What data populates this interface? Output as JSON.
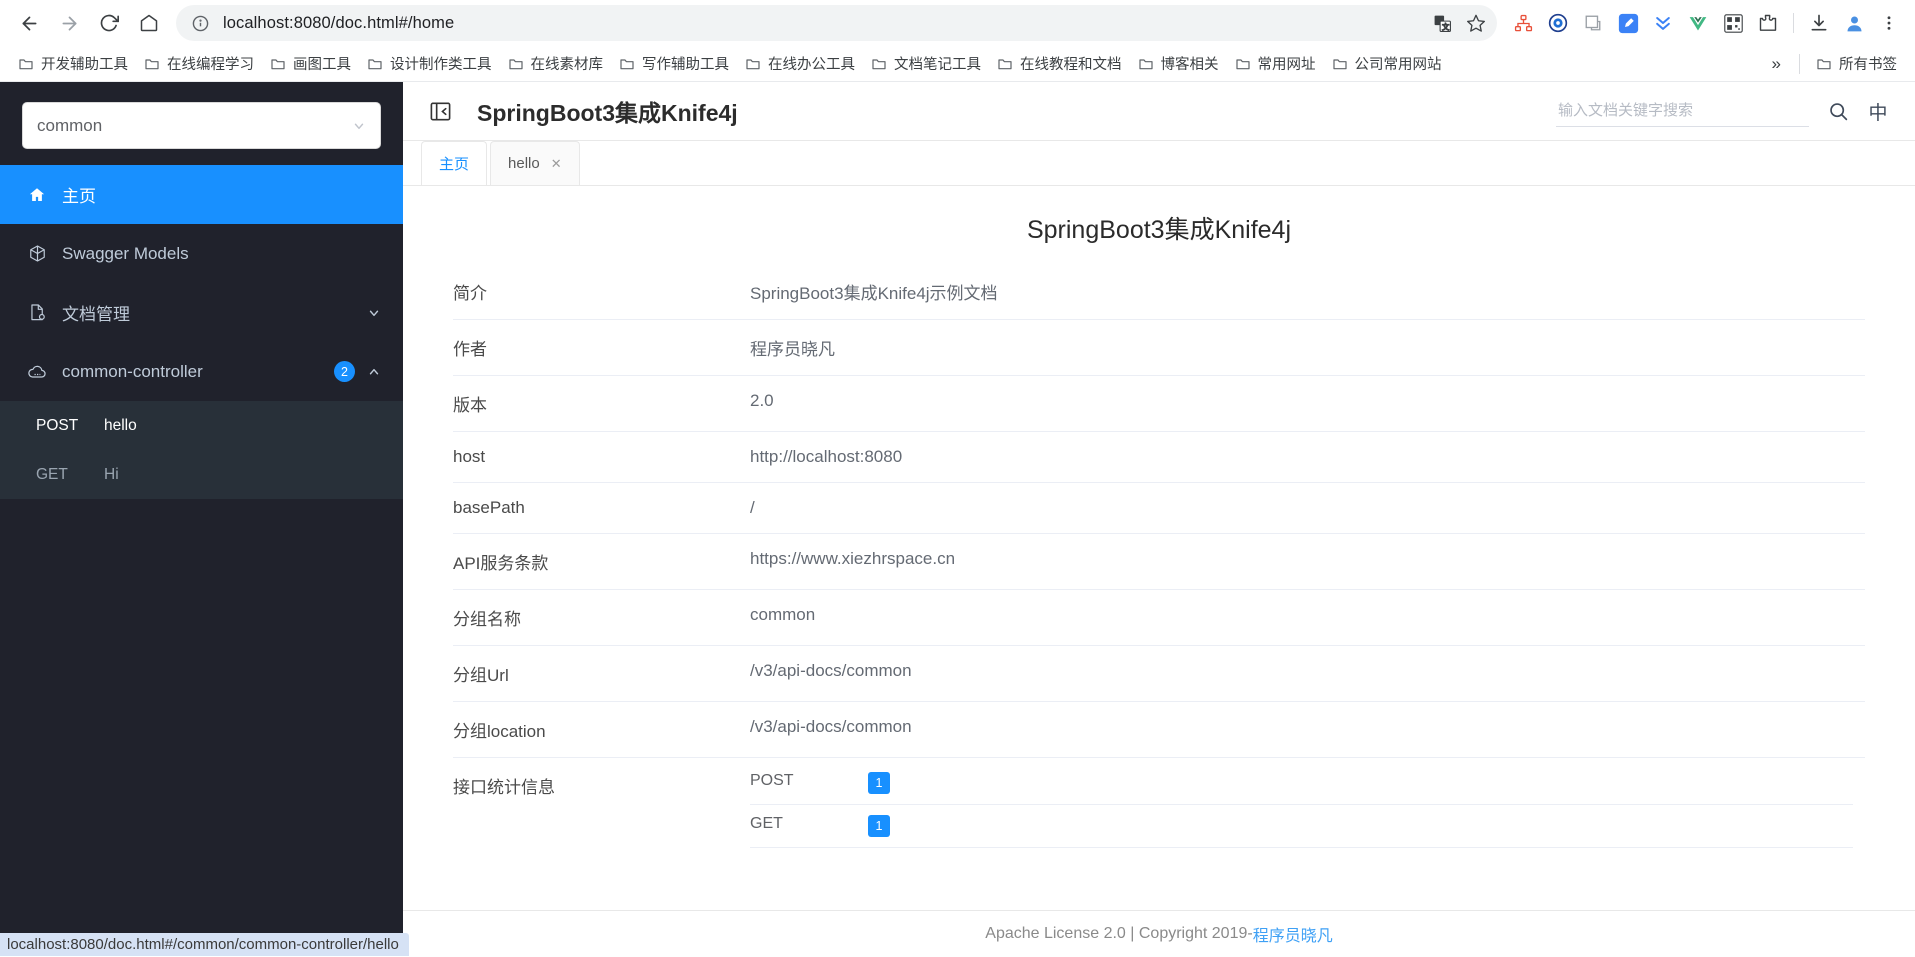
{
  "browser": {
    "url": "localhost:8080/doc.html#/home",
    "nav": {
      "back": "back-button",
      "forward": "forward-button",
      "reload": "reload-button",
      "home": "home-button"
    },
    "bookmarks": [
      "开发辅助工具",
      "在线编程学习",
      "画图工具",
      "设计制作类工具",
      "在线素材库",
      "写作辅助工具",
      "在线办公工具",
      "文档笔记工具",
      "在线教程和文档",
      "博客相关",
      "常用网址",
      "公司常用网站"
    ],
    "bookmarks_overflow": "»",
    "all_bookmarks": "所有书签",
    "status_text": "localhost:8080/doc.html#/common/common-controller/hello"
  },
  "sidebar": {
    "group_select": {
      "value": "common"
    },
    "menu": [
      {
        "label": "主页",
        "icon": "home-icon",
        "active": true
      },
      {
        "label": "Swagger Models",
        "icon": "cube-icon",
        "active": false
      },
      {
        "label": "文档管理",
        "icon": "document-gear-icon",
        "active": false,
        "arrow": "chevron-down"
      },
      {
        "label": "common-controller",
        "icon": "cloud-icon",
        "active": false,
        "badge": "2",
        "arrow": "chevron-up"
      }
    ],
    "submenu": [
      {
        "method": "POST",
        "name": "hello",
        "selected": true
      },
      {
        "method": "GET",
        "name": "Hi",
        "selected": false
      }
    ]
  },
  "header": {
    "collapse_icon": "menu-fold-icon",
    "title": "SpringBoot3集成Knife4j",
    "search_placeholder": "输入文档关键字搜索",
    "search_value": "",
    "search_icon": "search-icon",
    "lang_toggle": "中"
  },
  "tabs": [
    {
      "label": "主页",
      "active": true,
      "closable": false
    },
    {
      "label": "hello",
      "active": false,
      "closable": true,
      "close": "✕"
    }
  ],
  "content": {
    "title": "SpringBoot3集成Knife4j",
    "rows": [
      {
        "label": "简介",
        "value": "SpringBoot3集成Knife4j示例文档"
      },
      {
        "label": "作者",
        "value": "程序员晓凡"
      },
      {
        "label": "版本",
        "value": "2.0"
      },
      {
        "label": "host",
        "value": "http://localhost:8080"
      },
      {
        "label": "basePath",
        "value": "/"
      },
      {
        "label": "API服务条款",
        "value": "https://www.xiezhrspace.cn"
      },
      {
        "label": "分组名称",
        "value": "common"
      },
      {
        "label": "分组Url",
        "value": "/v3/api-docs/common"
      },
      {
        "label": "分组location",
        "value": "/v3/api-docs/common"
      }
    ],
    "stats_label": "接口统计信息",
    "stats": [
      {
        "method": "POST",
        "count": "1"
      },
      {
        "method": "GET",
        "count": "1"
      }
    ]
  },
  "footer": {
    "text": "Apache License 2.0 | Copyright 2019-",
    "link": "程序员晓凡"
  },
  "colors": {
    "accent": "#1890ff",
    "sidebar_bg": "#20222c",
    "submenu_bg": "#283039",
    "link": "#3ea0f5"
  }
}
